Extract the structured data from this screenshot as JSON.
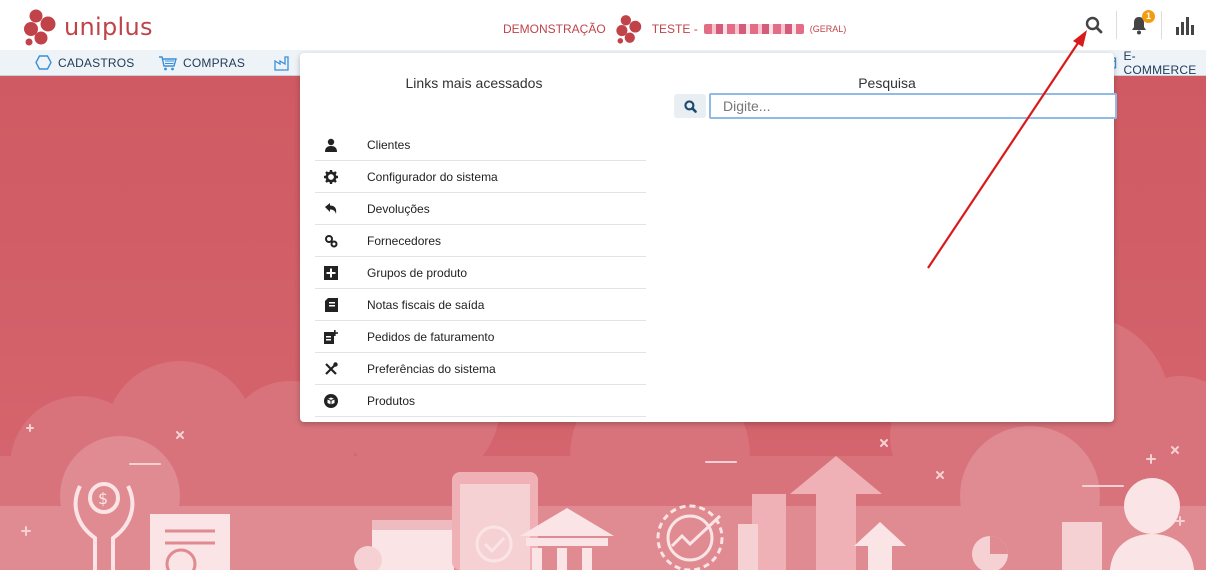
{
  "app": {
    "logo_text": "uniplus"
  },
  "header": {
    "company_label": "DEMONSTRAÇÃO",
    "user_prefix": "TESTE -",
    "branch_label": "(GERAL)",
    "notification_count": "1"
  },
  "menu": {
    "items": [
      {
        "label": "CADASTROS",
        "icon": "hexagon-icon"
      },
      {
        "label": "COMPRAS",
        "icon": "cart-icon"
      },
      {
        "label": "E-COMMERCE",
        "icon": "ecommerce-icon"
      }
    ]
  },
  "popup": {
    "links_title": "Links mais acessados",
    "search_title": "Pesquisa",
    "search_placeholder": "Digite...",
    "links": [
      {
        "label": "Clientes",
        "icon": "user-icon"
      },
      {
        "label": "Configurador do sistema",
        "icon": "gear-icon"
      },
      {
        "label": "Devoluções",
        "icon": "undo-icon"
      },
      {
        "label": "Fornecedores",
        "icon": "gears-icon"
      },
      {
        "label": "Grupos de produto",
        "icon": "plus-square-icon"
      },
      {
        "label": "Notas fiscais de saída",
        "icon": "invoice-icon"
      },
      {
        "label": "Pedidos de faturamento",
        "icon": "order-add-icon"
      },
      {
        "label": "Preferências do sistema",
        "icon": "tools-icon"
      },
      {
        "label": "Produtos",
        "icon": "box-icon"
      }
    ]
  },
  "colors": {
    "brand": "#c1434a",
    "hero": "#cf5a63",
    "menu_text": "#1e3a58",
    "badge": "#f39c12"
  }
}
